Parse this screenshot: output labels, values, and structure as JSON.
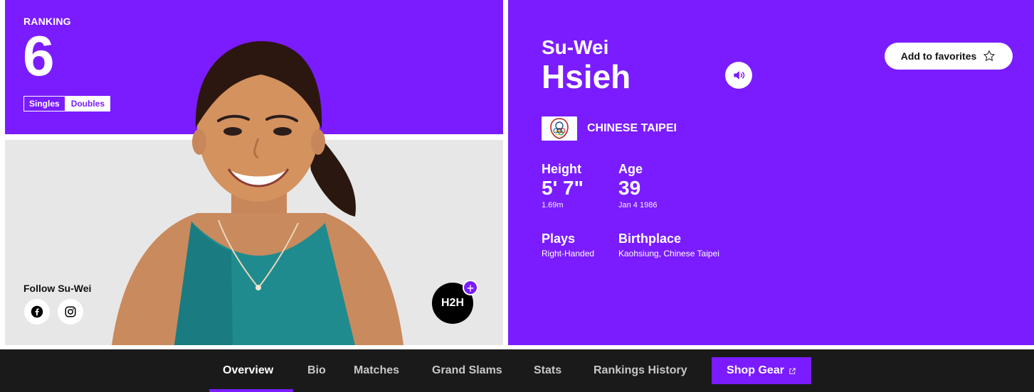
{
  "colors": {
    "brand_purple": "#7a1cff",
    "nav_bg": "#1a1a1a"
  },
  "ranking": {
    "label": "RANKING",
    "value": "6",
    "tabs": [
      "Singles",
      "Doubles"
    ],
    "active_tab": "Singles"
  },
  "follow": {
    "label": "Follow Su-Wei",
    "icons": [
      "facebook-icon",
      "instagram-icon"
    ]
  },
  "h2h": {
    "label": "H2H",
    "plus": "+"
  },
  "player": {
    "first_name": "Su-Wei",
    "last_name": "Hsieh",
    "country": "CHINESE TAIPEI",
    "favorites_label": "Add to favorites",
    "stats": {
      "height_label": "Height",
      "height_value": "5' 7\"",
      "height_metric": "1.69m",
      "age_label": "Age",
      "age_value": "39",
      "birthdate": "Jan 4 1986",
      "plays_label": "Plays",
      "plays_value": "Right-Handed",
      "birthplace_label": "Birthplace",
      "birthplace_value": "Kaohsiung, Chinese Taipei"
    }
  },
  "nav": {
    "items": [
      "Overview",
      "Bio",
      "Matches",
      "Grand Slams",
      "Stats",
      "Rankings History"
    ],
    "active": "Overview",
    "shop_label": "Shop Gear"
  }
}
